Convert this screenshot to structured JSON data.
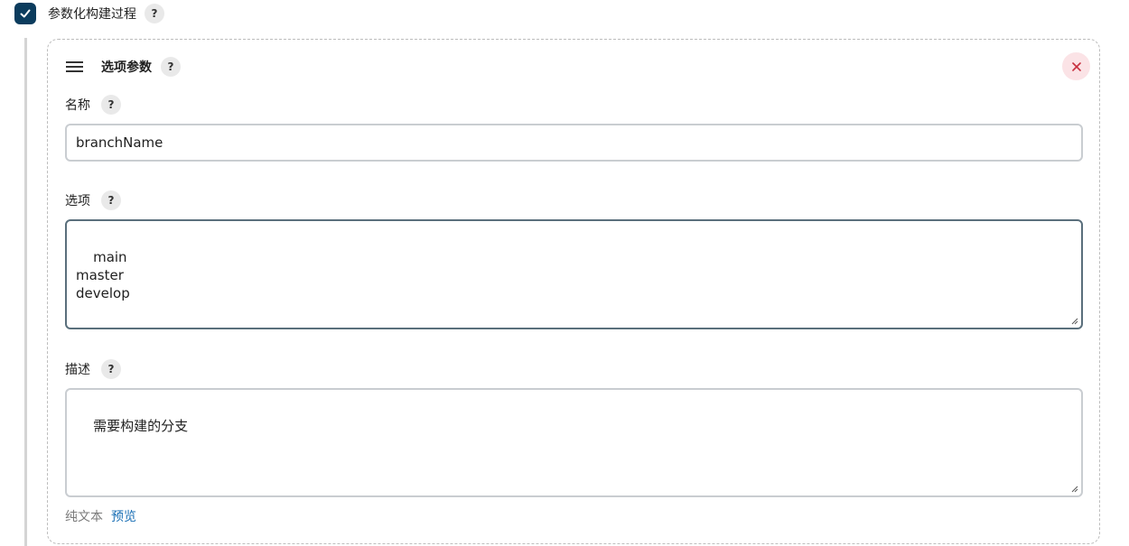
{
  "parameterized": {
    "label": "参数化构建过程",
    "checked": true,
    "help": "?"
  },
  "card": {
    "title": "选项参数",
    "help": "?",
    "close_icon": "close-icon",
    "drag_icon": "drag-handle-icon"
  },
  "fields": {
    "name": {
      "label": "名称",
      "help": "?",
      "value": "branchName"
    },
    "choices": {
      "label": "选项",
      "help": "?",
      "value": "main\nmaster\ndevelop"
    },
    "description": {
      "label": "描述",
      "help": "?",
      "value": "需要构建的分支"
    }
  },
  "footer": {
    "plain_text": "纯文本",
    "preview": "预览"
  },
  "colors": {
    "checkbox": "#0b3c5d",
    "close_bg": "#fbe3e6",
    "close_x": "#c8303f",
    "link": "#1a6fb5"
  }
}
